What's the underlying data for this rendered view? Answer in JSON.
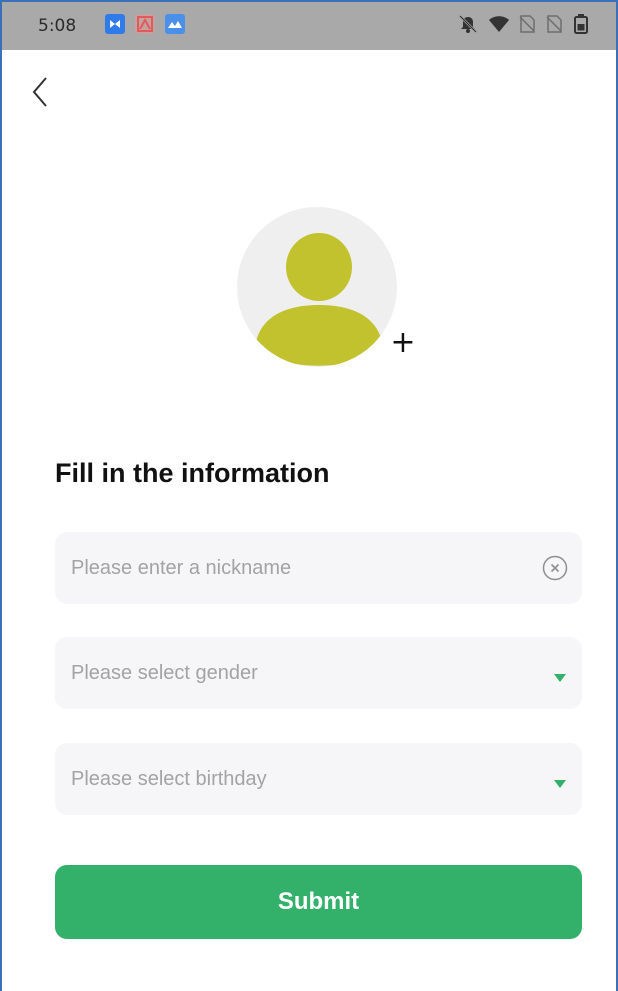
{
  "status_bar": {
    "time": "5:08",
    "icons": [
      "app-blue-icon",
      "app-red-icon",
      "app-blue-photo-icon",
      "mute-bell-icon",
      "wifi-icon",
      "no-sim-icon",
      "no-sim-icon",
      "battery-icon"
    ]
  },
  "header": {
    "back_icon": "chevron-left-icon"
  },
  "avatar": {
    "icon": "person-avatar-icon",
    "add_icon_text": "+",
    "color": "#c2c22e",
    "background": "#f0eff0"
  },
  "form": {
    "title": "Fill in the information",
    "nickname": {
      "placeholder": "Please enter a nickname",
      "value": "",
      "clear_icon": "clear-circle-icon"
    },
    "gender": {
      "placeholder": "Please select gender",
      "value": "",
      "icon": "dropdown-triangle-icon"
    },
    "birthday": {
      "placeholder": "Please select birthday",
      "value": "",
      "icon": "dropdown-triangle-icon"
    }
  },
  "submit": {
    "label": "Submit",
    "color": "#33b06a"
  },
  "colors": {
    "accent": "#33b06a",
    "field_bg": "#f6f5f7",
    "placeholder_text": "#a3a3a3",
    "status_bar_bg": "#a9a9a9"
  }
}
